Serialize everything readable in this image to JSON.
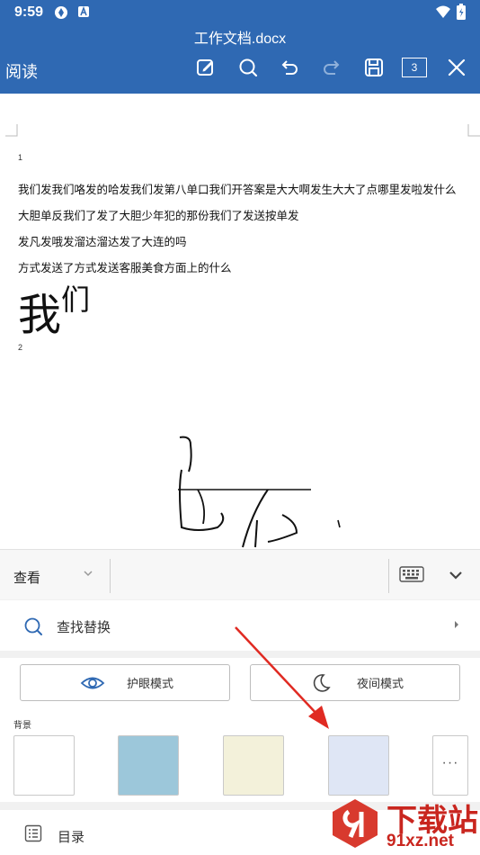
{
  "status_bar": {
    "time": "9:59"
  },
  "header": {
    "doc_title": "工作文档.docx",
    "mode_label": "阅读",
    "page_count": "3"
  },
  "document": {
    "page1_number": "1",
    "lines": [
      "我们发我们咯发的哈发我们发第八单口我们开答案是大大啊发生大大了点哪里发啦发什么",
      "大胆单反我们了发了大胆少年犯的那份我们了发送按单发",
      "发凡发哦发溜达溜达发了大连的吗",
      "方式发送了方式发送客服美食方面上的什么"
    ],
    "big_text_main": "我",
    "big_text_small": "们",
    "page2_number": "2"
  },
  "panel": {
    "view_label": "查看",
    "find_replace": "查找替换",
    "eye_mode": "护眼模式",
    "night_mode": "夜间模式",
    "background_label": "背景",
    "backgrounds": [
      {
        "name": "white",
        "color": "#ffffff"
      },
      {
        "name": "blue",
        "color": "#9cc7da"
      },
      {
        "name": "beige",
        "color": "#f3f1da"
      },
      {
        "name": "lavender",
        "color": "#dfe6f5"
      }
    ],
    "more_label": "···",
    "toc_label": "目录"
  },
  "watermark": {
    "brand": "下载站",
    "url": "91xz.net"
  },
  "colors": {
    "header": "#2f69b3",
    "annotation": "#e02a22"
  }
}
